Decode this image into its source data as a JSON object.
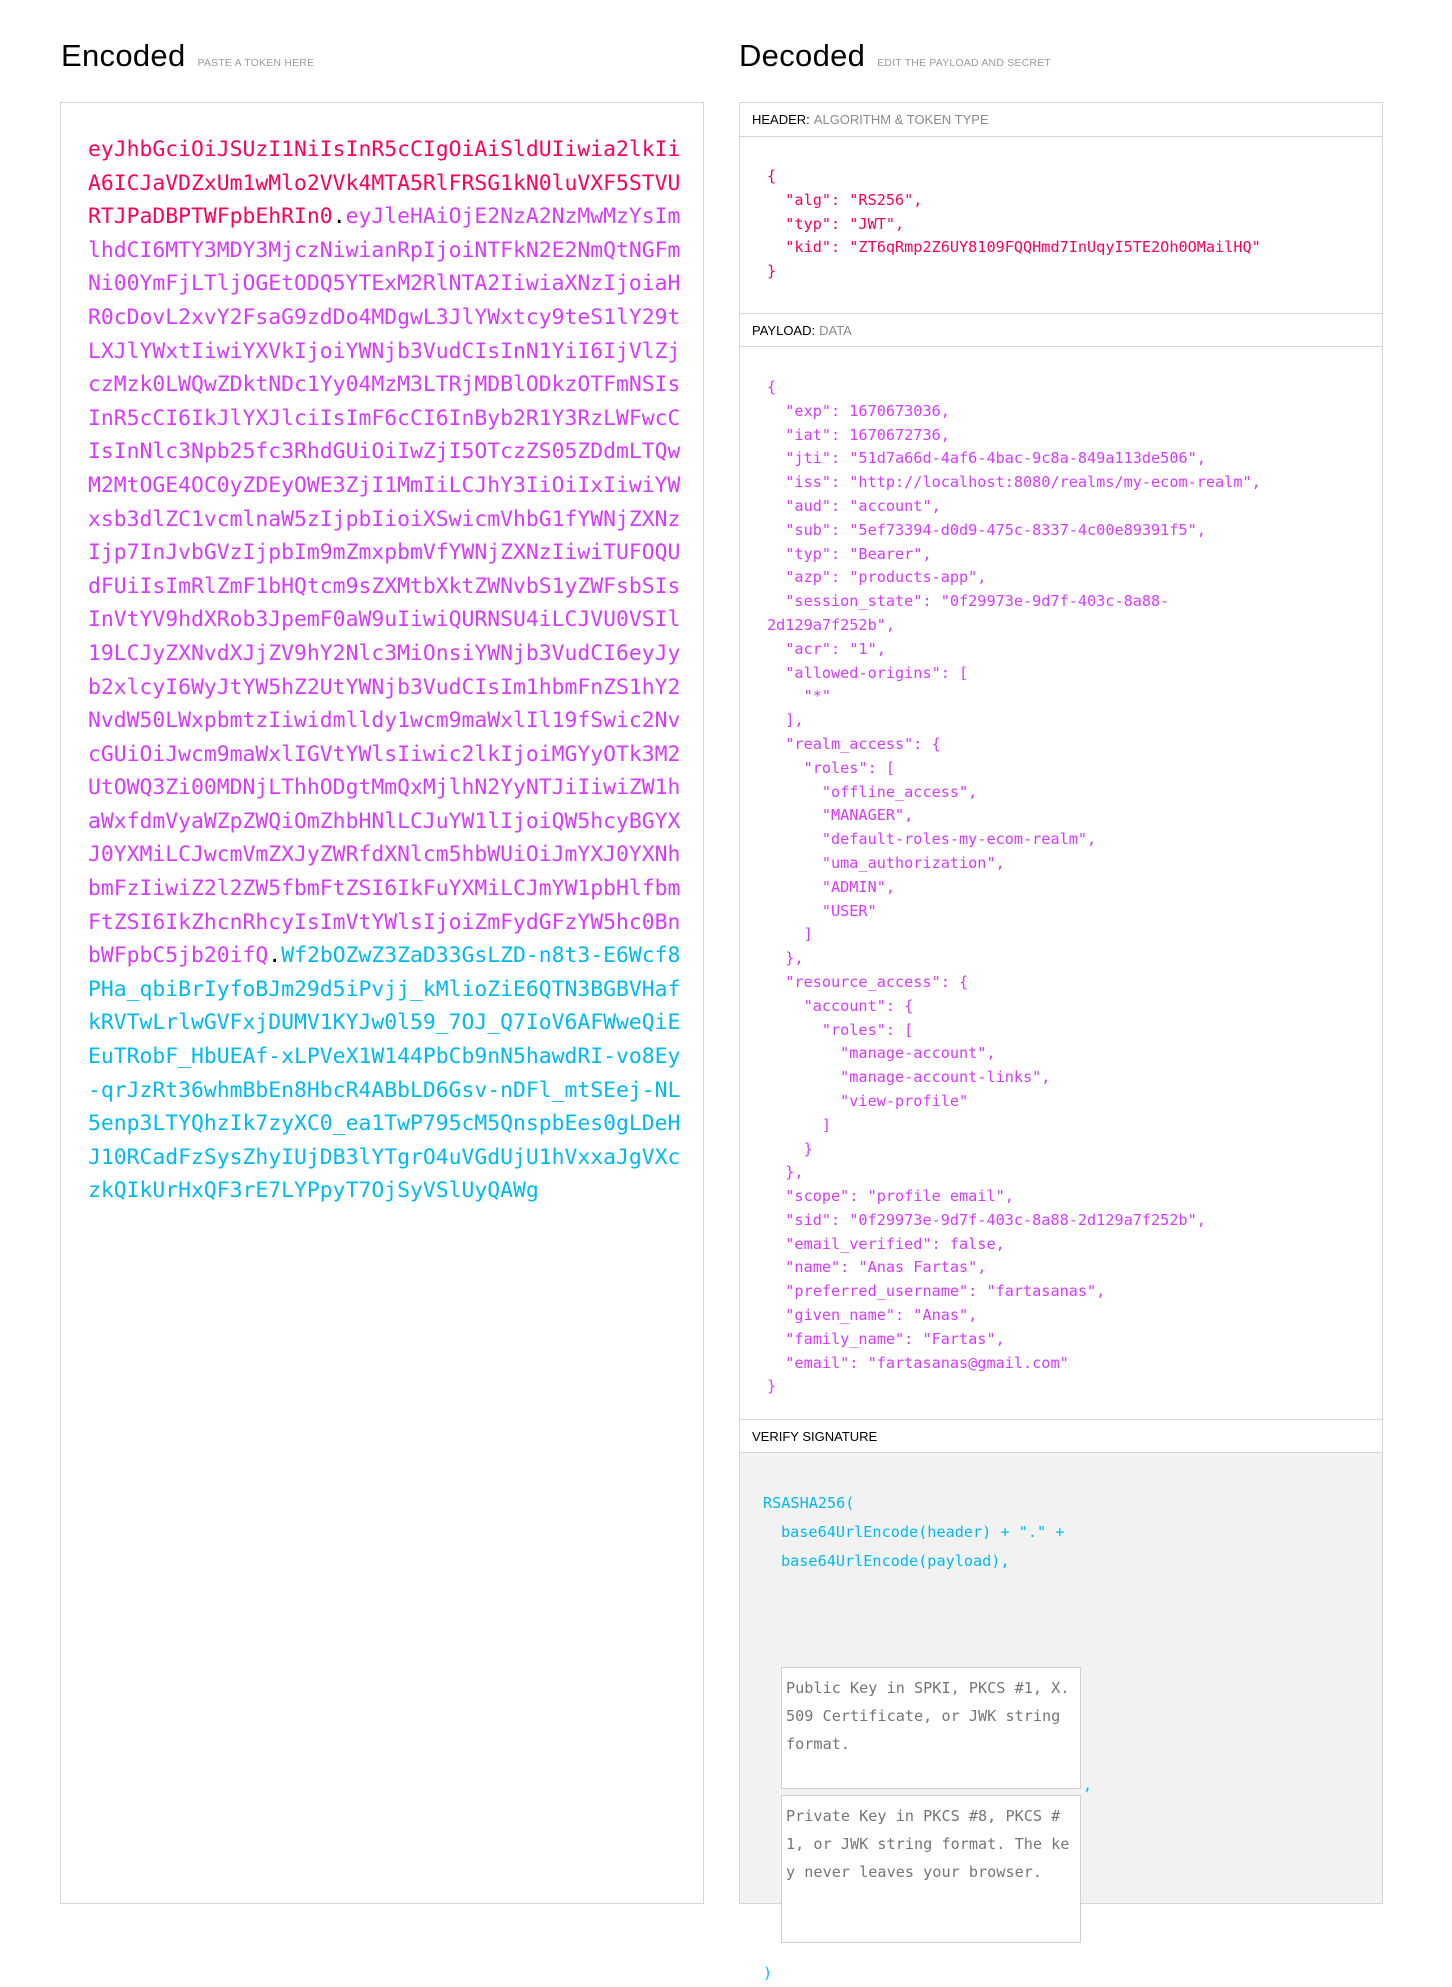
{
  "encoded": {
    "title": "Encoded",
    "subtitle": "PASTE A TOKEN HERE",
    "token_header": "eyJhbGciOiJSUzI1NiIsInR5cCIgOiAiSldUIiwia2lkIiA6ICJaVDZxUm1wMlo2VVk4MTA5RlFRSG1kN0luVXF5STVURTJPaDBPTWFpbEhRIn0",
    "token_payload": "eyJleHAiOjE2NzA2NzMwMzYsImlhdCI6MTY3MDY3MjczNiwianRpIjoiNTFkN2E2NmQtNGFmNi00YmFjLTljOGEtODQ5YTExM2RlNTA2IiwiaXNzIjoiaHR0cDovL2xvY2FsaG9zdDo4MDgwL3JlYWxtcy9teS1lY29tLXJlYWxtIiwiYXVkIjoiYWNjb3VudCIsInN1YiI6IjVlZjczMzk0LWQwZDktNDc1Yy04MzM3LTRjMDBlODkzOTFmNSIsInR5cCI6IkJlYXJlciIsImF6cCI6InByb2R1Y3RzLWFwcCIsInNlc3Npb25fc3RhdGUiOiIwZjI5OTczZS05ZDdmLTQwM2MtOGE4OC0yZDEyOWE3ZjI1MmIiLCJhY3IiOiIxIiwiYWxsb3dlZC1vcmlnaW5zIjpbIioiXSwicmVhbG1fYWNjZXNzIjp7InJvbGVzIjpbIm9mZmxpbmVfYWNjZXNzIiwiTUFOQUdFUiIsImRlZmF1bHQtcm9sZXMtbXktZWNvbS1yZWFsbSIsInVtYV9hdXRob3JpemF0aW9uIiwiQURNSU4iLCJVU0VSIl19LCJyZXNvdXJjZV9hY2Nlc3MiOnsiYWNjb3VudCI6eyJyb2xlcyI6WyJtYW5hZ2UtYWNjb3VudCIsIm1hbmFnZS1hY2NvdW50LWxpbmtzIiwidmlldy1wcm9maWxlIl19fSwic2NvcGUiOiJwcm9maWxlIGVtYWlsIiwic2lkIjoiMGYyOTk3M2UtOWQ3Zi00MDNjLThhODgtMmQxMjlhN2YyNTJiIiwiZW1haWxfdmVyaWZpZWQiOmZhbHNlLCJuYW1lIjoiQW5hcyBGYXJ0YXMiLCJwcmVmZXJyZWRfdXNlcm5hbWUiOiJmYXJ0YXNhbmFzIiwiZ2l2ZW5fbmFtZSI6IkFuYXMiLCJmYW1pbHlfbmFtZSI6IkZhcnRhcyIsImVtYWlsIjoiZmFydGFzYW5hc0BnbWFpbC5jb20ifQ",
    "token_signature": "Wf2bOZwZ3ZaD33GsLZD-n8t3-E6Wcf8PHa_qbiBrIyfoBJm29d5iPvjj_kMlioZiE6QTN3BGBVHafkRVTwLrlwGVFxjDUMV1KYJw0l59_7OJ_Q7IoV6AFWweQiEEuTRobF_HbUEAf-xLPVeX1W144PbCb9nN5hawdRI-vo8Ey-qrJzRt36whmBbEn8HbcR4ABbLD6Gsv-nDFl_mtSEej-NL5enp3LTYQhzIk7zyXC0_ea1TwP795cM5QnspbEes0gLDeHJ10RCadFzSysZhyIUjDB3lYTgrO4uVGdUjU1hVxxaJgVXczkQIkUrHxQF3rE7LYPpyT7OjSyVSlUyQAWg",
    "dot": "."
  },
  "decoded": {
    "title": "Decoded",
    "subtitle": "EDIT THE PAYLOAD AND SECRET",
    "header_section": {
      "label": "HEADER:",
      "sublabel": "ALGORITHM & TOKEN TYPE"
    },
    "payload_section": {
      "label": "PAYLOAD:",
      "sublabel": "DATA"
    },
    "signature_section": {
      "label": "VERIFY SIGNATURE"
    },
    "header_json": "{\n  \"alg\": \"RS256\",\n  \"typ\": \"JWT\",\n  \"kid\": \"ZT6qRmp2Z6UY8109FQQHmd7InUqyI5TE2Oh0OMailHQ\"\n}",
    "payload_json": "{\n  \"exp\": 1670673036,\n  \"iat\": 1670672736,\n  \"jti\": \"51d7a66d-4af6-4bac-9c8a-849a113de506\",\n  \"iss\": \"http://localhost:8080/realms/my-ecom-realm\",\n  \"aud\": \"account\",\n  \"sub\": \"5ef73394-d0d9-475c-8337-4c00e89391f5\",\n  \"typ\": \"Bearer\",\n  \"azp\": \"products-app\",\n  \"session_state\": \"0f29973e-9d7f-403c-8a88-\n2d129a7f252b\",\n  \"acr\": \"1\",\n  \"allowed-origins\": [\n    \"*\"\n  ],\n  \"realm_access\": {\n    \"roles\": [\n      \"offline_access\",\n      \"MANAGER\",\n      \"default-roles-my-ecom-realm\",\n      \"uma_authorization\",\n      \"ADMIN\",\n      \"USER\"\n    ]\n  },\n  \"resource_access\": {\n    \"account\": {\n      \"roles\": [\n        \"manage-account\",\n        \"manage-account-links\",\n        \"view-profile\"\n      ]\n    }\n  },\n  \"scope\": \"profile email\",\n  \"sid\": \"0f29973e-9d7f-403c-8a88-2d129a7f252b\",\n  \"email_verified\": false,\n  \"name\": \"Anas Fartas\",\n  \"preferred_username\": \"fartasanas\",\n  \"given_name\": \"Anas\",\n  \"family_name\": \"Fartas\",\n  \"email\": \"fartasanas@gmail.com\"\n}",
    "signature": {
      "func": "RSASHA256(",
      "line1": "base64UrlEncode(header) + \".\" +",
      "line2": "base64UrlEncode(payload),",
      "comma": ",",
      "public_key_placeholder": "Public Key in SPKI, PKCS #1, X.509 Certificate, or JWK string format.",
      "private_key_placeholder": "Private Key in PKCS #8, PKCS #1, or JWK string format. The key never leaves your browser.",
      "close": ")"
    }
  },
  "colors": {
    "header": "#fb015b",
    "payload": "#d63aff",
    "signature": "#00b9f1"
  }
}
